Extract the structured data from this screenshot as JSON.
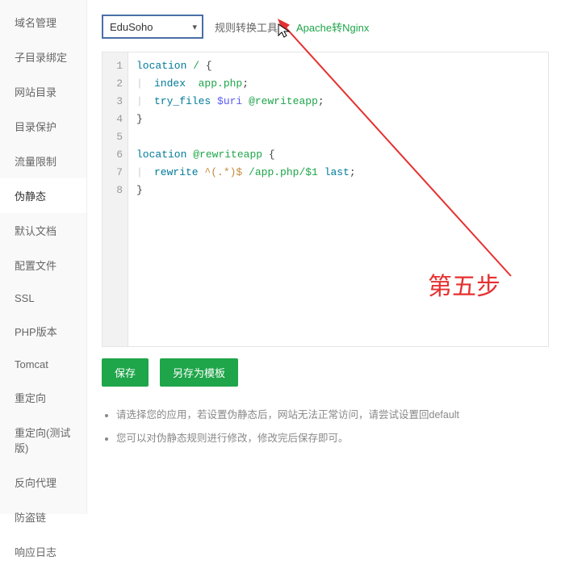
{
  "sidebar": {
    "items": [
      {
        "label": "域名管理",
        "active": false
      },
      {
        "label": "子目录绑定",
        "active": false
      },
      {
        "label": "网站目录",
        "active": false
      },
      {
        "label": "目录保护",
        "active": false
      },
      {
        "label": "流量限制",
        "active": false
      },
      {
        "label": "伪静态",
        "active": true
      },
      {
        "label": "默认文档",
        "active": false
      },
      {
        "label": "配置文件",
        "active": false
      },
      {
        "label": "SSL",
        "active": false
      },
      {
        "label": "PHP版本",
        "active": false
      },
      {
        "label": "Tomcat",
        "active": false
      },
      {
        "label": "重定向",
        "active": false
      },
      {
        "label": "重定向(测试版)",
        "active": false
      },
      {
        "label": "反向代理",
        "active": false
      },
      {
        "label": "防盗链",
        "active": false
      },
      {
        "label": "响应日志",
        "active": false
      }
    ]
  },
  "toolbar": {
    "select_value": "EduSoho",
    "convert_label": "规则转换工具：",
    "convert_link": "Apache转Nginx"
  },
  "editor": {
    "line_numbers": [
      1,
      2,
      3,
      4,
      5,
      6,
      7,
      8
    ],
    "lines": [
      "location / {",
      "    index  app.php;",
      "    try_files $uri @rewriteapp;",
      "}",
      "",
      "location @rewriteapp {",
      "    rewrite ^(.*)$ /app.php/$1 last;",
      "}"
    ]
  },
  "buttons": {
    "save": "保存",
    "save_as_tpl": "另存为模板"
  },
  "hints": [
    "请选择您的应用，若设置伪静态后，网站无法正常访问，请尝试设置回default",
    "您可以对伪静态规则进行修改，修改完后保存即可。"
  ],
  "annotation": {
    "label": "第五步"
  }
}
